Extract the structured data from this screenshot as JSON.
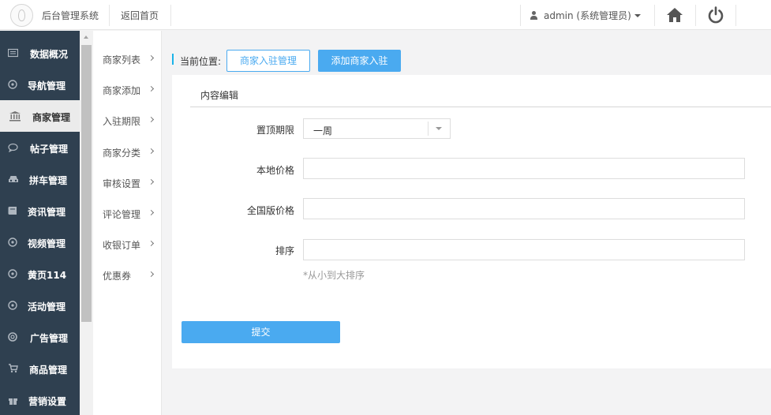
{
  "header": {
    "system_title": "后台管理系统",
    "home_link": "返回首页",
    "user_label": "admin (系统管理员)"
  },
  "sidebar": {
    "items": [
      {
        "label": "数据概况",
        "icon": "dashboard-icon"
      },
      {
        "label": "导航管理",
        "icon": "compass-icon"
      },
      {
        "label": "商家管理",
        "icon": "bank-icon",
        "active": true
      },
      {
        "label": "帖子管理",
        "icon": "comment-icon"
      },
      {
        "label": "拼车管理",
        "icon": "car-icon"
      },
      {
        "label": "资讯管理",
        "icon": "book-icon"
      },
      {
        "label": "视频管理",
        "icon": "compass-icon"
      },
      {
        "label": "黄页114",
        "icon": "compass-icon"
      },
      {
        "label": "活动管理",
        "icon": "compass-icon"
      },
      {
        "label": "广告管理",
        "icon": "lifebuoy-icon"
      },
      {
        "label": "商品管理",
        "icon": "cart-icon"
      },
      {
        "label": "营销设置",
        "icon": "gift-icon"
      }
    ]
  },
  "submenu": {
    "items": [
      "商家列表",
      "商家添加",
      "入驻期限",
      "商家分类",
      "审核设置",
      "评论管理",
      "收银订单",
      "优惠券"
    ]
  },
  "breadcrumb": {
    "label": "当前位置:",
    "items": [
      "商家入驻管理",
      "添加商家入驻"
    ]
  },
  "panel": {
    "title": "内容编辑",
    "fields": {
      "period_label": "置顶期限",
      "period_value": "一周",
      "local_price_label": "本地价格",
      "national_price_label": "全国版价格",
      "sort_label": "排序",
      "sort_hint": "*从小到大排序"
    },
    "submit_label": "提交"
  },
  "colors": {
    "sidebar_bg": "#2f4050",
    "accent": "#4aaaf0",
    "breadcrumb_bar": "#1ab3e9"
  }
}
